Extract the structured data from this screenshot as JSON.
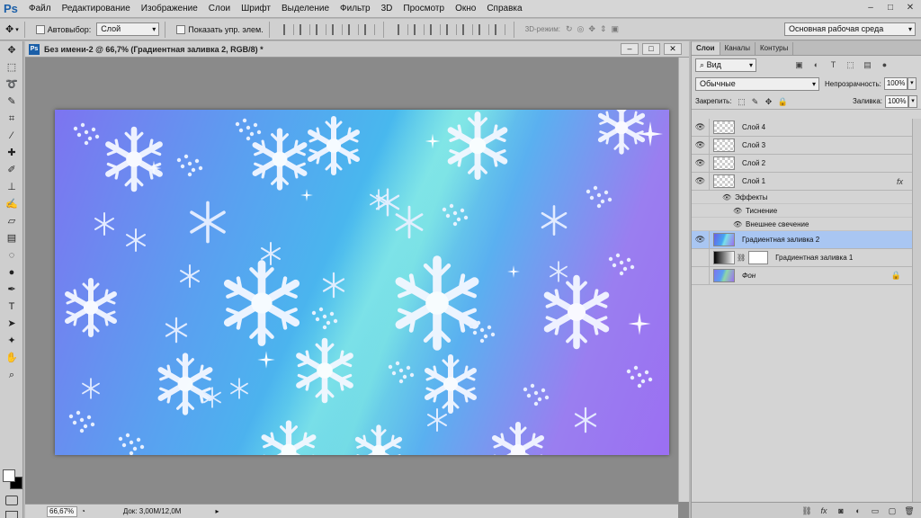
{
  "app": {
    "logo": "Ps",
    "menu": [
      "Файл",
      "Редактирование",
      "Изображение",
      "Слои",
      "Шрифт",
      "Выделение",
      "Фильтр",
      "3D",
      "Просмотр",
      "Окно",
      "Справка"
    ],
    "window_controls": [
      "–",
      "□",
      "✕"
    ]
  },
  "options": {
    "autoselect_label": "Автовыбор:",
    "autoselect_value": "Слой",
    "show_controls_label": "Показать упр. элем.",
    "mode_3d_label": "3D-режим:",
    "workspace": "Основная рабочая среда"
  },
  "document": {
    "ps_icon": "Ps",
    "title": "Без имени-2 @ 66,7% (Градиентная заливка 2, RGB/8) *",
    "zoom": "66,67%",
    "doc_size": "Док: 3,00M/12,0M",
    "win_controls": [
      "–",
      "□",
      "✕"
    ]
  },
  "tools": {
    "side_number": "17"
  },
  "layers_panel": {
    "tabs": [
      "Слои",
      "Каналы",
      "Контуры"
    ],
    "kind_filter": "Вид",
    "blend_mode": "Обычные",
    "opacity_label": "Непрозрачность:",
    "opacity_value": "100%",
    "lock_label": "Закрепить:",
    "fill_label": "Заливка:",
    "fill_value": "100%",
    "layers": [
      {
        "name": "Слой 4",
        "visible": true
      },
      {
        "name": "Слой 3",
        "visible": true
      },
      {
        "name": "Слой 2",
        "visible": true
      },
      {
        "name": "Слой 1",
        "visible": true,
        "fx": "fx"
      },
      {
        "name": "Градиентная заливка 2",
        "visible": true,
        "selected": true
      },
      {
        "name": "Градиентная заливка 1",
        "visible": false
      },
      {
        "name": "Фон",
        "visible": false,
        "locked": true
      }
    ],
    "effects_label": "Эффекты",
    "effects": [
      "Тиснение",
      "Внешнее свечение"
    ]
  },
  "colors": {
    "accent": "#a9c6f2",
    "foreground": "#ffffff",
    "background": "#000000"
  }
}
